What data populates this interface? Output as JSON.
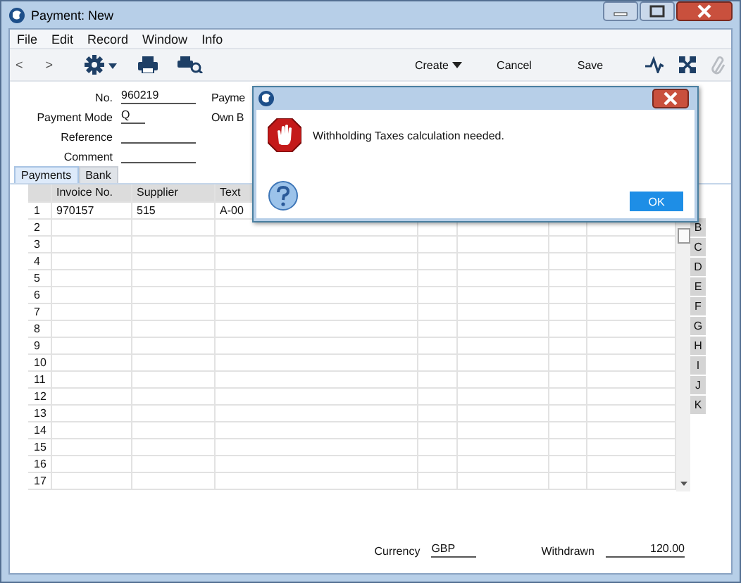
{
  "window": {
    "title": "Payment: New"
  },
  "menu": [
    "File",
    "Edit",
    "Record",
    "Window",
    "Info"
  ],
  "toolbar": {
    "back": "<",
    "forward": ">",
    "buttons": [
      {
        "label": "Create",
        "dropdown": true
      },
      {
        "label": "Cancel",
        "dropdown": false
      },
      {
        "label": "Save",
        "dropdown": false
      }
    ],
    "attach_disabled": true
  },
  "header_fields": [
    {
      "label": "No.",
      "value": "960219"
    },
    {
      "label": "Payment Mode",
      "value": "Q"
    },
    {
      "label": "Reference"
    },
    {
      "label": "Comment"
    }
  ],
  "header_fields_right": [
    "Payme",
    "Own B"
  ],
  "tabs": [
    {
      "label": "Payments",
      "selected": true
    },
    {
      "label": "Bank",
      "selected": false
    }
  ],
  "table": {
    "columns": [
      "Invoice No.",
      "Supplier",
      "Text"
    ],
    "rows": [
      {
        "number": "1",
        "cells": [
          "970157",
          "515",
          "A-00"
        ]
      },
      {
        "number": "2"
      },
      {
        "number": "3"
      },
      {
        "number": "4"
      },
      {
        "number": "5"
      },
      {
        "number": "6"
      },
      {
        "number": "7"
      },
      {
        "number": "8"
      },
      {
        "number": "9"
      },
      {
        "number": "10"
      },
      {
        "number": "11"
      },
      {
        "number": "12"
      },
      {
        "number": "13"
      },
      {
        "number": "14"
      },
      {
        "number": "15"
      },
      {
        "number": "16"
      },
      {
        "number": "17"
      }
    ]
  },
  "row_tabs": [
    "B",
    "C",
    "D",
    "E",
    "F",
    "G",
    "H",
    "I",
    "J",
    "K"
  ],
  "footer": [
    {
      "label": "Currency",
      "value": "GBP",
      "kind": "short"
    },
    {
      "label": "Withdrawn",
      "value": "120.00",
      "kind": "amount"
    }
  ],
  "dialog": {
    "message": "Withholding Taxes calculation needed.",
    "button": "OK"
  }
}
